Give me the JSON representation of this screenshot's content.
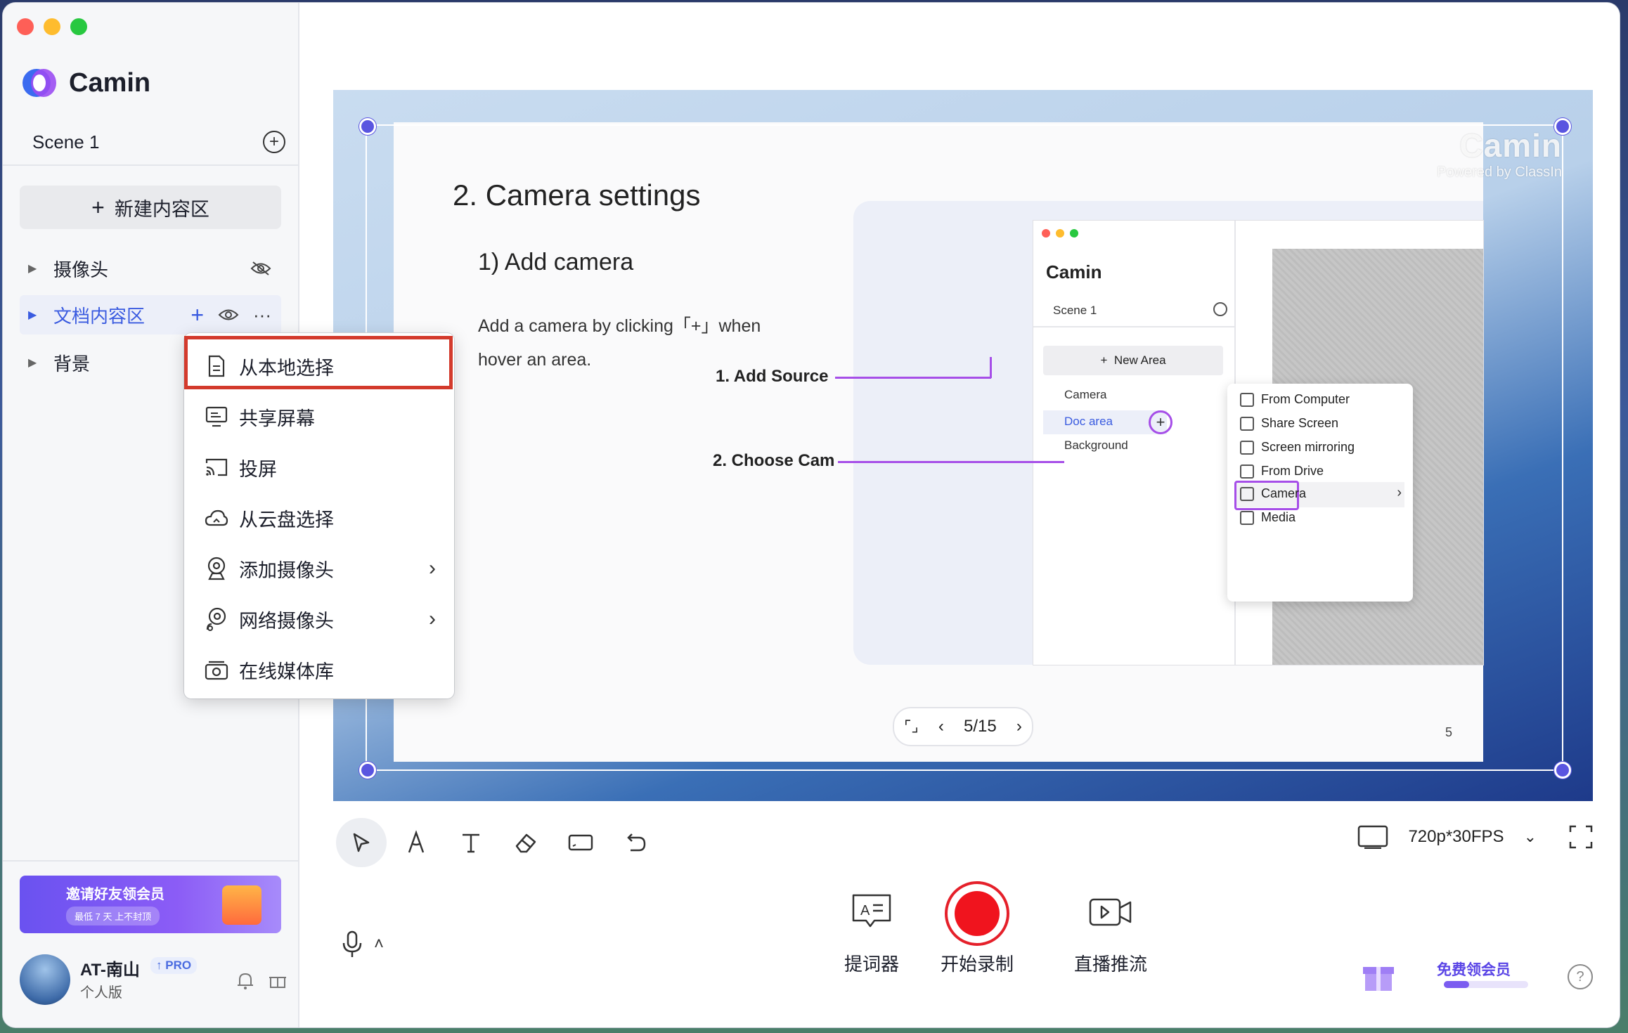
{
  "app": {
    "name": "Camin"
  },
  "sidebar": {
    "scene_label": "Scene 1",
    "new_area_label": "新建内容区",
    "items": [
      {
        "label": "摄像头",
        "icon": "eye-off-icon"
      },
      {
        "label": "文档内容区",
        "active": true
      },
      {
        "label": "背景"
      }
    ],
    "promo": {
      "title": "邀请好友领会员",
      "sub": "最低 7 天 上不封顶"
    },
    "user": {
      "name": "AT-南山",
      "badge": "PRO",
      "plan": "个人版"
    }
  },
  "context_menu": {
    "items": [
      {
        "label": "从本地选择",
        "icon": "file-icon",
        "highlighted": true
      },
      {
        "label": "共享屏幕",
        "icon": "monitor-icon"
      },
      {
        "label": "投屏",
        "icon": "cast-icon"
      },
      {
        "label": "从云盘选择",
        "icon": "cloud-icon"
      },
      {
        "label": "添加摄像头",
        "icon": "webcam-icon",
        "submenu": true
      },
      {
        "label": "网络摄像头",
        "icon": "network-cam-icon",
        "submenu": true
      },
      {
        "label": "在线媒体库",
        "icon": "media-library-icon"
      }
    ]
  },
  "slide": {
    "title": "2. Camera settings",
    "subtitle": "1)  Add camera",
    "text_line1": "Add a camera by clicking「+」when",
    "text_line2": "hover an area.",
    "callout1": "1. Add Source",
    "callout2": "2. Choose Cam",
    "page_counter": "5/15",
    "page_number": "5",
    "watermark": "Camin",
    "watermark_sub": "Powered by ClassIn",
    "mini_app": {
      "name": "Camin",
      "scene": "Scene 1",
      "new_area": "New Area",
      "items": [
        "Camera",
        "Doc area",
        "Background"
      ],
      "menu": [
        "From Computer",
        "Share Screen",
        "Screen mirroring",
        "From Drive",
        "Camera",
        "Media"
      ]
    }
  },
  "toolbar": {
    "resolution": "720p*30FPS"
  },
  "controls": {
    "teleprompter": "提词器",
    "record": "开始录制",
    "stream": "直播推流"
  },
  "vip": {
    "label": "免费领会员",
    "progress": 0.3
  },
  "colors": {
    "accent": "#3a5be0",
    "record": "#f0141e",
    "highlight": "#d33a2c",
    "callout": "#a64ee8"
  }
}
